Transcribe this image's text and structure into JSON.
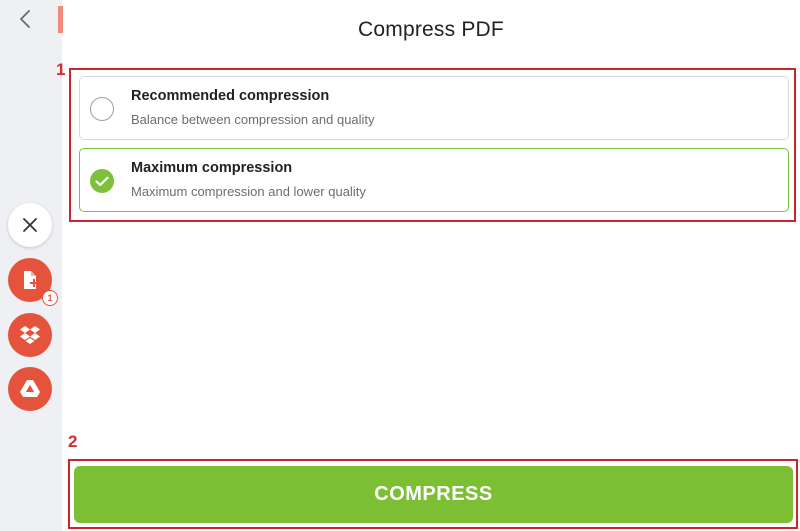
{
  "header": {
    "title": "Compress PDF"
  },
  "sidebar": {
    "back_icon": "chevron-left-icon",
    "close_icon": "close-icon",
    "actions": [
      {
        "icon": "add-file-icon",
        "badge": "1"
      },
      {
        "icon": "dropbox-icon"
      },
      {
        "icon": "google-drive-icon"
      }
    ],
    "accent_color": "#e5533d"
  },
  "options": [
    {
      "title": "Recommended compression",
      "description": "Balance between compression and quality",
      "selected": false
    },
    {
      "title": "Maximum compression",
      "description": "Maximum compression and lower quality",
      "selected": true
    }
  ],
  "annotations": {
    "options_label": "1",
    "button_label": "2",
    "color": "#c8252c"
  },
  "action": {
    "compress_label": "COMPRESS",
    "color": "#7cbf35"
  }
}
